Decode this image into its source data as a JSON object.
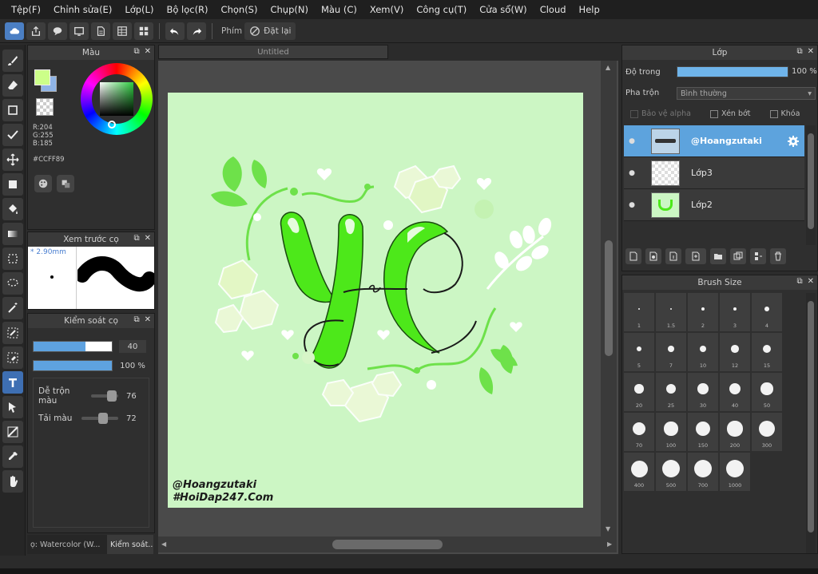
{
  "menu": [
    "Tệp(F)",
    "Chỉnh sửa(E)",
    "Lớp(L)",
    "Bộ lọc(R)",
    "Chọn(S)",
    "Chụp(N)",
    "Màu (C)",
    "Xem(V)",
    "Công cụ(T)",
    "Cửa sổ(W)",
    "Cloud",
    "Help"
  ],
  "toolbar": {
    "key_label": "Phím",
    "reset_label": "Đặt lại"
  },
  "color_panel": {
    "title": "Màu",
    "r": "R:204",
    "g": "G:255",
    "b": "B:185",
    "hex": "#CCFF89",
    "primary_color": "#ccff89"
  },
  "brush_preview": {
    "title": "Xem trước cọ",
    "size": "2.90mm"
  },
  "brush_control": {
    "title": "Kiểm soát cọ",
    "size_value": "40",
    "size_fill": 0.66,
    "opacity_value": "100 %",
    "opacity_fill": 1.0,
    "blend_label": "Dễ trộn màu",
    "blend_value": "76",
    "blend_level": 0.76,
    "amount_label": "Tải màu",
    "amount_value": "72",
    "amount_level": 0.72
  },
  "bottom_tabs": [
    "ọ: Watercolor (W...",
    "Kiểm soát..."
  ],
  "document": {
    "tab_title": "Untitled",
    "signature_line1": "@Hoangzutaki",
    "signature_line2": "#HoiDap247.Com",
    "background": "#ccf6c4"
  },
  "layer_panel": {
    "title": "Lớp",
    "opacity_label": "Độ trong",
    "opacity_value": "100 %",
    "blend_label": "Pha trộn",
    "blend_value": "Bình thường",
    "protect_alpha": "Bảo vệ alpha",
    "clipping": "Xén bớt",
    "lock": "Khóa",
    "layers": [
      {
        "name": "@Hoangzutaki",
        "selected": true
      },
      {
        "name": "Lớp3",
        "selected": false
      },
      {
        "name": "Lớp2",
        "selected": false
      }
    ]
  },
  "brush_size_panel": {
    "title": "Brush Size",
    "sizes": [
      "1",
      "1.5",
      "2",
      "3",
      "4",
      "5",
      "7",
      "10",
      "12",
      "15",
      "20",
      "25",
      "30",
      "40",
      "50",
      "70",
      "100",
      "150",
      "200",
      "300",
      "400",
      "500",
      "700",
      "1000"
    ]
  },
  "icons": {
    "tools": [
      "brush-icon",
      "eraser-icon",
      "rectangle-icon",
      "check-icon",
      "move-icon",
      "fill-rect-icon",
      "bucket-icon",
      "gradient-icon",
      "select-rect-icon",
      "lasso-icon",
      "magic-wand-icon",
      "select-pen-icon",
      "select-eraser-icon",
      "text-icon",
      "operation-icon",
      "divide-icon",
      "eyedropper-icon",
      "hand-icon"
    ]
  }
}
